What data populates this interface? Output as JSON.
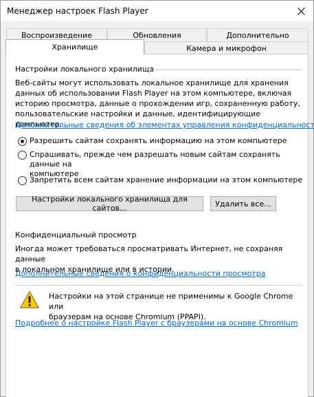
{
  "window": {
    "title": "Менеджер настроек Flash Player"
  },
  "tabs": {
    "row1": [
      "Воспроизведение",
      "Обновления",
      "Дополнительно"
    ],
    "row2": [
      "Хранилище",
      "Камера и микрофон"
    ],
    "active": "Хранилище"
  },
  "storage": {
    "section_title": "Настройки локального хранилища",
    "description_lines": [
      "Веб-сайты могут использовать локальное хранилище для хранения",
      "данных об использовании Flash Player на этом компьютере, включая",
      "историю просмотра, данные о прохождении игр, сохраненную работу,",
      "пользовательские настройки и данные, идентифицирующие компьютер."
    ],
    "privacy_link": "Дополнительные сведения об элементах управления конфиденциальностью",
    "options": [
      {
        "label": "Разрешить сайтам сохранять информацию на этом компьютере",
        "checked": true
      },
      {
        "label_lines": [
          "Спрашивать, прежде чем разрешать новым сайтам сохранять данные на",
          "компьютере"
        ],
        "checked": false
      },
      {
        "label": "Запретить всем сайтам хранение информации на этом компьютере",
        "checked": false
      }
    ],
    "site_settings_button": "Настройки локального хранилища для сайтов...",
    "delete_all_button": "Удалить все..."
  },
  "private_browsing": {
    "section_title": "Конфиденциальный просмотр",
    "description_lines": [
      "Иногда может требоваться просматривать Интернет, не сохраняя данные",
      "в локальном хранилище или в истории."
    ],
    "link": "Дополнительные сведения о конфиденциальности просмотра"
  },
  "notice": {
    "text_lines": [
      "Настройки на этой странице не применимы к Google Chrome или",
      "браузерам на основе Chromium (PPAPI)."
    ],
    "link": "Подробнее о настройке Flash Player с браузерами на основе Chromium"
  },
  "colors": {
    "link": "#0066cc",
    "warning_fill": "#f5c518"
  }
}
